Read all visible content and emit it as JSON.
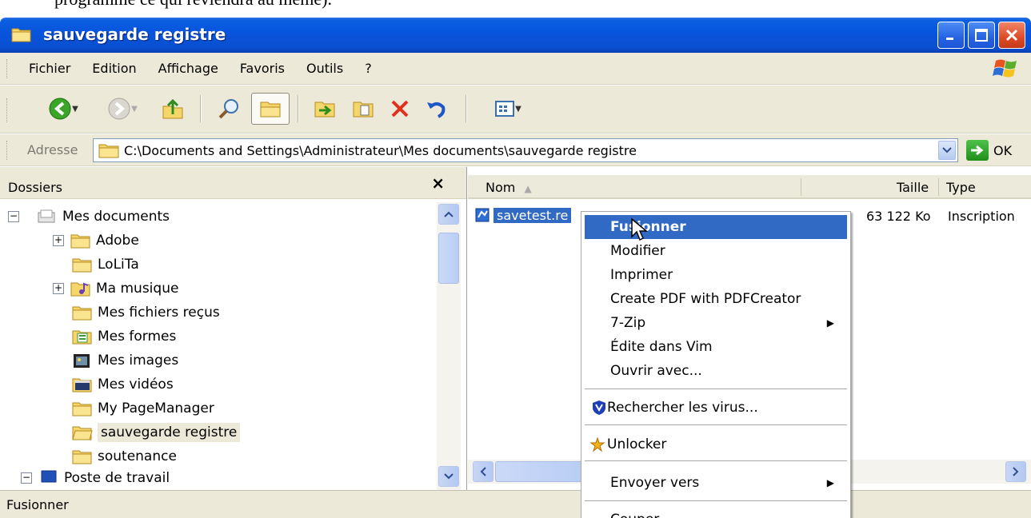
{
  "document_text": "programme ce qui reviendra au même).",
  "window": {
    "title": "sauvegarde registre",
    "controls": {
      "minimize": "minimize",
      "maximize": "maximize",
      "close": "close"
    }
  },
  "menu": {
    "items": [
      "Fichier",
      "Edition",
      "Affichage",
      "Favoris",
      "Outils",
      "?"
    ]
  },
  "toolbar": {
    "buttons": [
      "back",
      "forward",
      "up",
      "search",
      "folders",
      "move-to",
      "copy-to",
      "delete",
      "undo",
      "views"
    ]
  },
  "address": {
    "label": "Adresse",
    "path": "C:\\Documents and Settings\\Administrateur\\Mes documents\\sauvegarde registre",
    "go_label": "OK"
  },
  "folders_pane": {
    "title": "Dossiers",
    "close_glyph": "×",
    "tree": [
      {
        "label": "Mes documents",
        "icon": "documents-icon",
        "expander": "−"
      },
      {
        "label": "Adobe",
        "icon": "folder-icon",
        "expander": "+"
      },
      {
        "label": "LoLiTa",
        "icon": "folder-icon",
        "expander": ""
      },
      {
        "label": "Ma musique",
        "icon": "music-folder-icon",
        "expander": "+"
      },
      {
        "label": "Mes fichiers reçus",
        "icon": "folder-icon",
        "expander": ""
      },
      {
        "label": "Mes formes",
        "icon": "forms-folder-icon",
        "expander": ""
      },
      {
        "label": "Mes images",
        "icon": "images-folder-icon",
        "expander": ""
      },
      {
        "label": "Mes vidéos",
        "icon": "video-folder-icon",
        "expander": ""
      },
      {
        "label": "My PageManager",
        "icon": "folder-icon",
        "expander": ""
      },
      {
        "label": "sauvegarde registre",
        "icon": "folder-open-icon",
        "expander": "",
        "selected": true
      },
      {
        "label": "soutenance",
        "icon": "folder-icon",
        "expander": ""
      },
      {
        "label": "Poste de travail",
        "icon": "computer-icon",
        "expander": "−"
      }
    ]
  },
  "file_list": {
    "columns": {
      "name": "Nom",
      "size": "Taille",
      "type": "Type"
    },
    "rows": [
      {
        "name": "savetest.reg",
        "visible_name": "savetest.re",
        "size": "63 122 Ko",
        "type": "Inscription"
      }
    ]
  },
  "context_menu": {
    "items": [
      {
        "label": "Fusionner",
        "highlighted": true
      },
      {
        "label": "Modifier"
      },
      {
        "label": "Imprimer"
      },
      {
        "label": "Create PDF with PDFCreator"
      },
      {
        "label": "7-Zip",
        "submenu": true
      },
      {
        "label": "Édite dans Vim"
      },
      {
        "label": "Ouvrir avec..."
      },
      {
        "label": "Rechercher les virus...",
        "icon": "antivirus-shield-icon"
      },
      {
        "label": "Unlocker",
        "icon": "unlocker-icon"
      },
      {
        "label": "Envoyer vers",
        "submenu": true
      },
      {
        "label": "Couper"
      }
    ]
  },
  "status": {
    "text": "Fusionner"
  },
  "colors": {
    "titlebar": "#0855dd",
    "selection": "#316ac5",
    "chrome": "#ece9d8"
  }
}
